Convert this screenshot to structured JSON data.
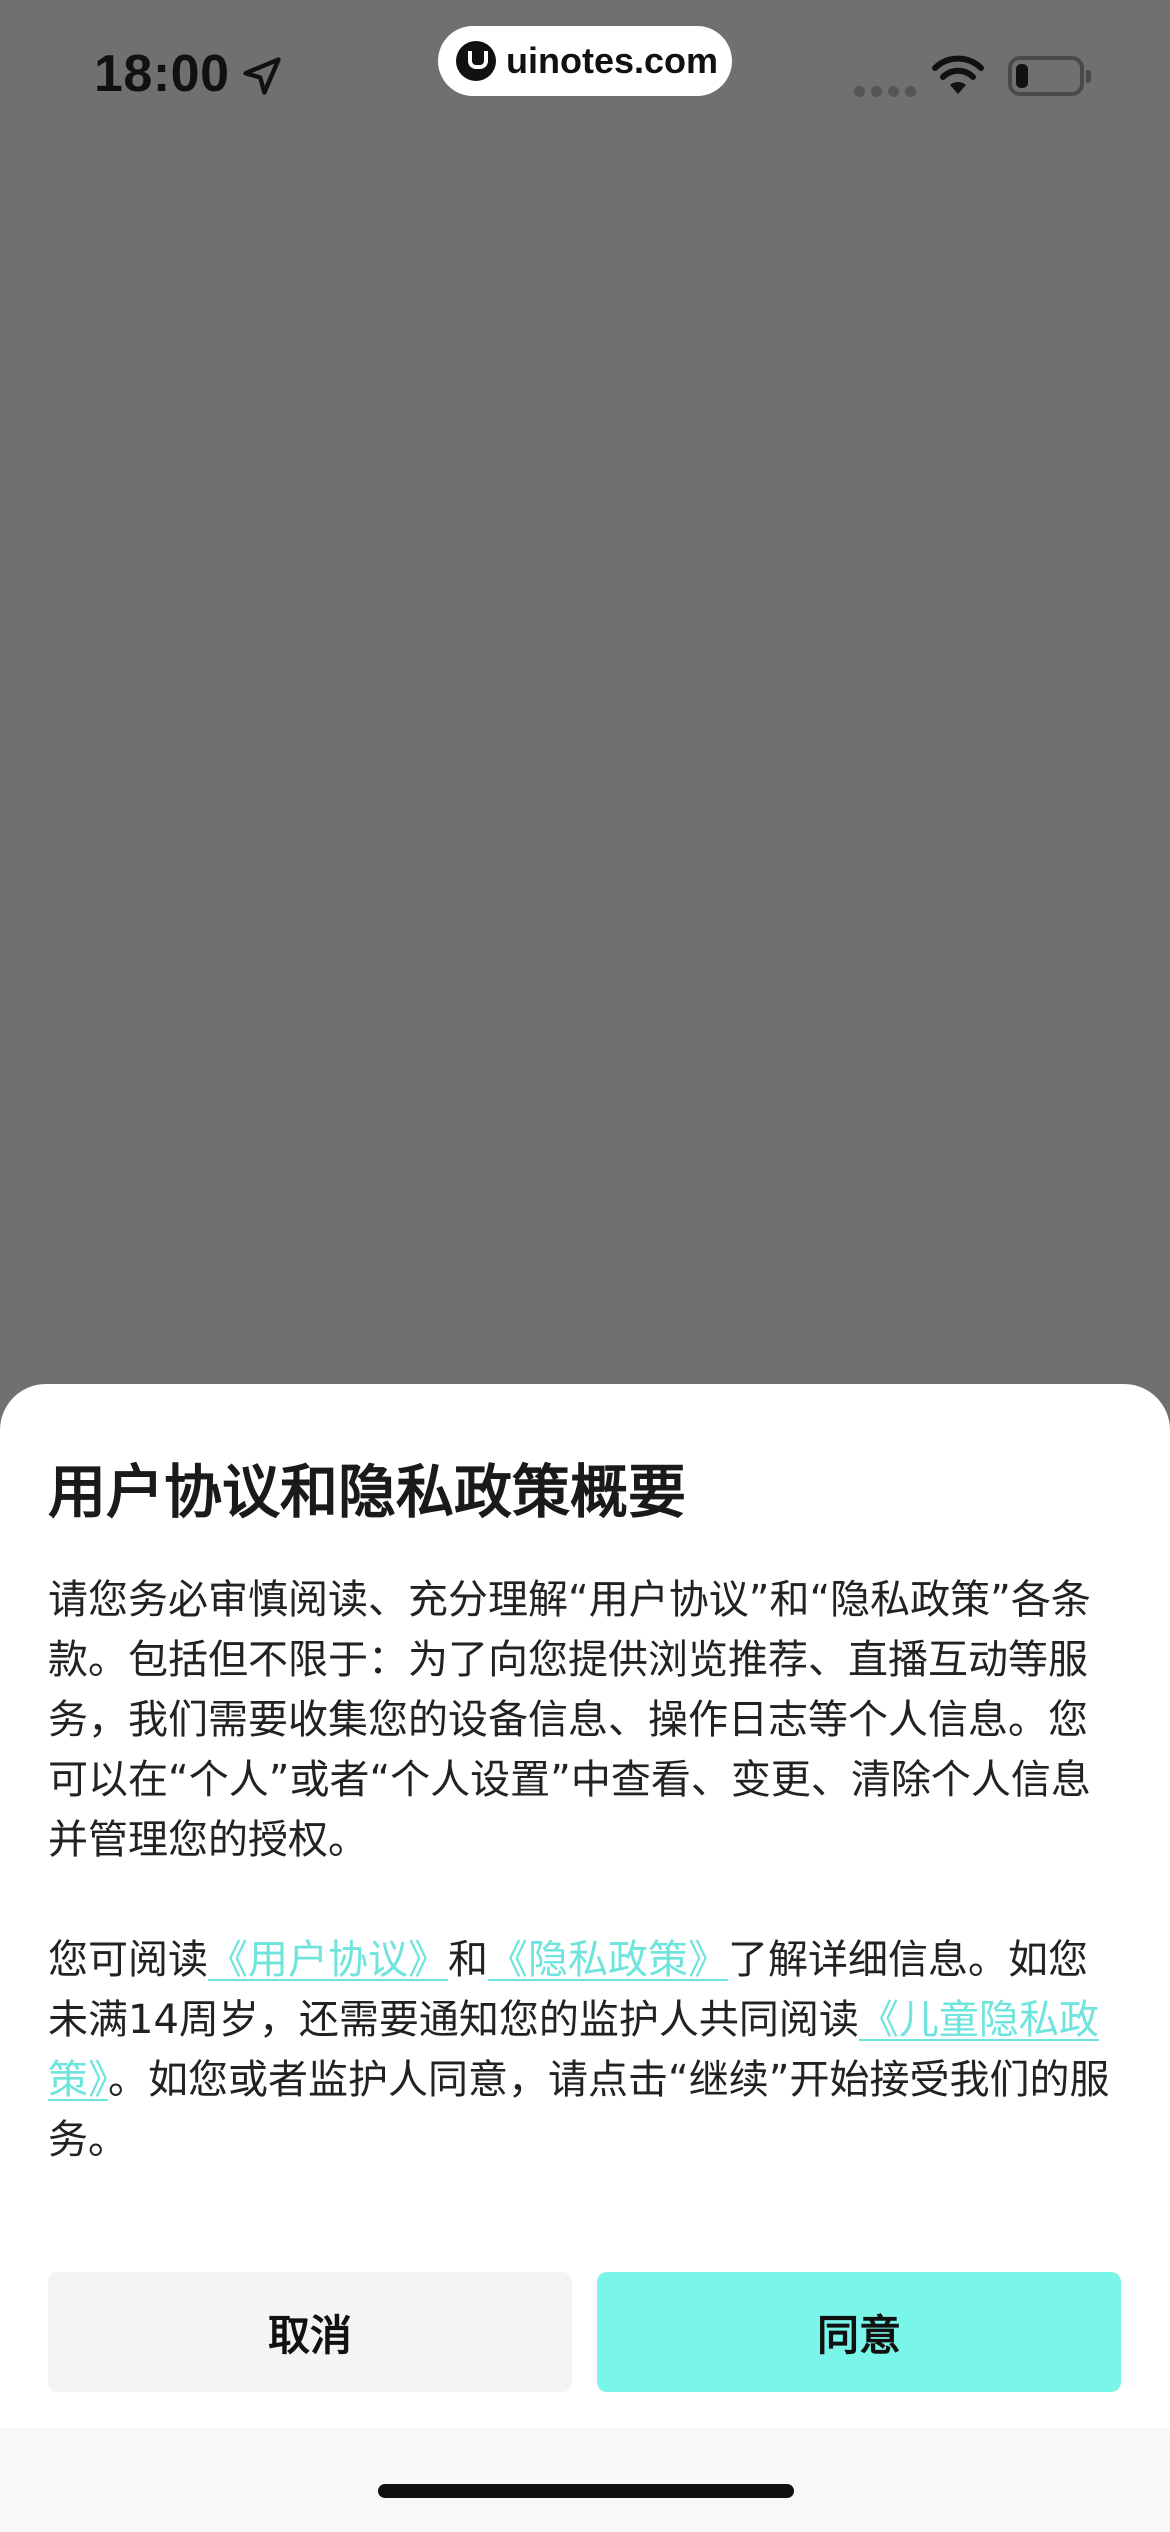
{
  "status_bar": {
    "time": "18:00",
    "location_icon": "location-arrow-icon",
    "wifi_icon": "wifi-icon",
    "battery_icon": "battery-icon",
    "battery_level": 0.2
  },
  "watermark": {
    "text": "uinotes.com",
    "icon": "uinotes-logo-icon"
  },
  "dialog": {
    "title": "用户协议和隐私政策概要",
    "paragraph1": "请您务必审慎阅读、充分理解“用户协议”和“隐私政策”各条款。包括但不限于：为了向您提供浏览推荐、直播互动等服务，我们需要收集您的设备信息、操作日志等个人信息。您可以在“个人”或者“个人设置”中查看、变更、清除个人信息并管理您的授权。",
    "paragraph2": {
      "text_a": "您可阅读",
      "link_user_agreement": "《用户协议》",
      "text_b": "和",
      "link_privacy_policy": "《隐私政策》",
      "text_c": "了解详细信息。如您未满14周岁，还需要通知您的监护人共同阅读",
      "link_child_privacy": "《儿童隐私政策》",
      "text_d": "。如您或者监护人同意，请点击“继续”开始接受我们的服务。"
    },
    "cancel_label": "取消",
    "agree_label": "同意"
  },
  "colors": {
    "overlay": "#707070",
    "link": "#6ee4dc",
    "agree_button": "#79f5ea",
    "cancel_button": "#f4f4f4"
  }
}
